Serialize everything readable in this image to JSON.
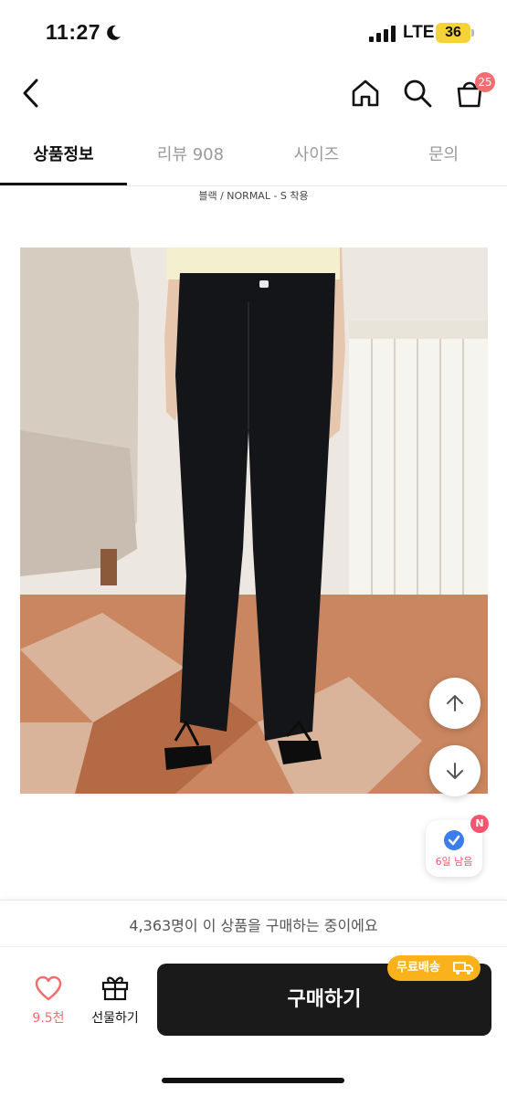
{
  "status_bar": {
    "time": "11:27",
    "network": "LTE",
    "battery": "36",
    "battery_color": "#f5d238"
  },
  "header": {
    "back_icon": "chevron-left-icon",
    "home_icon": "home-icon",
    "search_icon": "search-icon",
    "cart_icon": "shopping-bag-icon",
    "cart_count": "25",
    "badge_color": "#f26d6d"
  },
  "tabs": [
    {
      "label": "상품정보",
      "active": true
    },
    {
      "label": "리뷰 908",
      "active": false
    },
    {
      "label": "사이즈",
      "active": false
    },
    {
      "label": "문의",
      "active": false
    }
  ],
  "product": {
    "caption": "블랙 / NORMAL - S 착용",
    "image": "model-wearing-black-flared-jeans"
  },
  "floating": {
    "up_icon": "arrow-up-icon",
    "down_icon": "arrow-down-icon",
    "timer_badge": "N",
    "timer_text": "6일 남음",
    "timer_icon": "verified-check-icon"
  },
  "bottom_bar": {
    "buyers_text": "4,363명이 이 상품을 구매하는 중이에요",
    "like_icon": "heart-icon",
    "like_count": "9.5천",
    "gift_icon": "gift-icon",
    "gift_label": "선물하기",
    "buy_label": "구매하기",
    "shipping_badge": "무료배송",
    "shipping_icon": "truck-icon",
    "accent_color": "#f9b21c"
  }
}
